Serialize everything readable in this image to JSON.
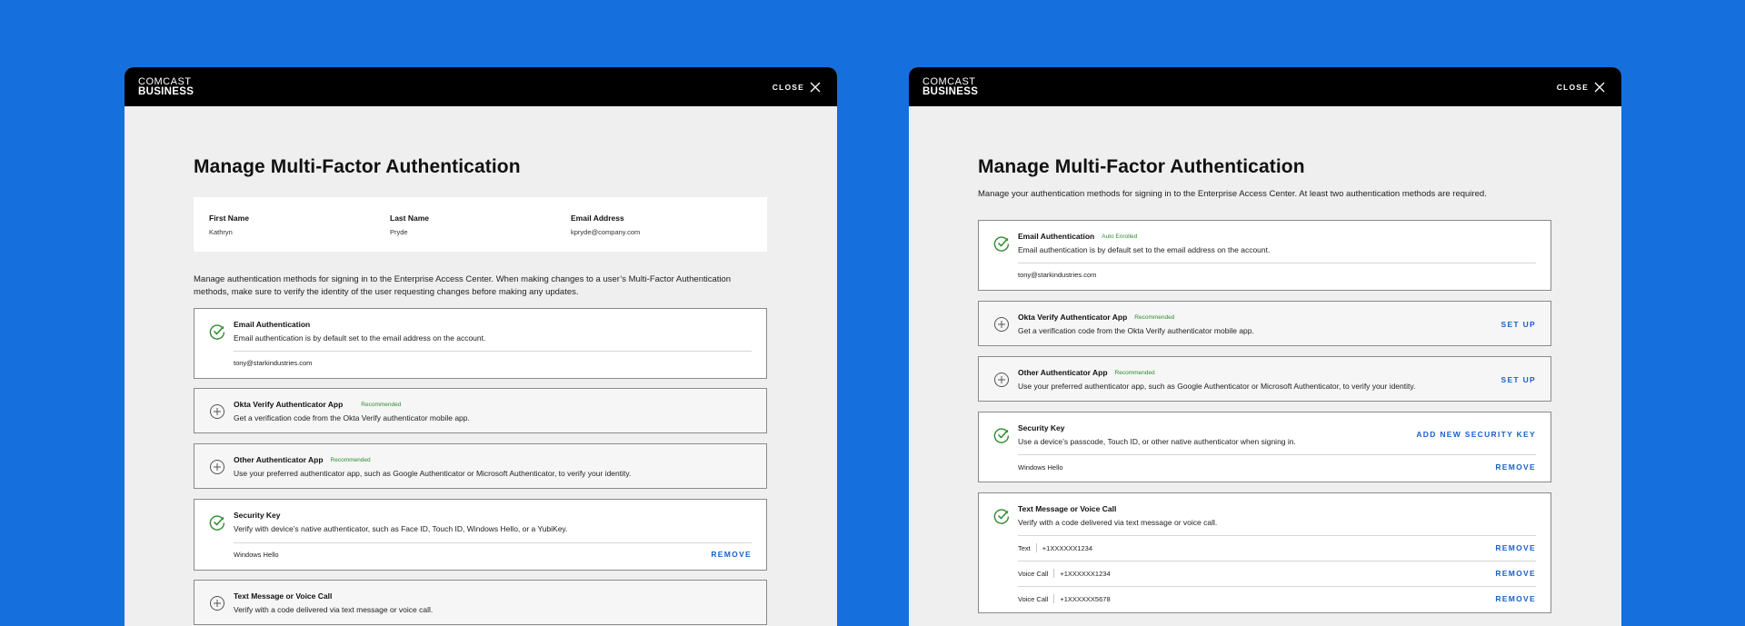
{
  "brand": {
    "line1": "COMCAST",
    "line2": "BUSINESS"
  },
  "close_label": "CLOSE",
  "colors": {
    "background": "#1570DE",
    "header": "#000000",
    "panel": "#EFEFEF",
    "success": "#2E8B2E",
    "link": "#1A5FC8"
  },
  "left": {
    "title": "Manage Multi-Factor Authentication",
    "user": {
      "first_name_label": "First Name",
      "first_name": "Kathryn",
      "last_name_label": "Last Name",
      "last_name": "Pryde",
      "email_label": "Email Address",
      "email": "kpryde@company.com"
    },
    "intro_line1": "Manage authentication methods for signing in to the Enterprise Access Center. When making changes to a user’s Multi-Factor Authentication",
    "intro_line2": "methods, make sure to verify the identity of the user requesting changes before making any updates.",
    "email_card": {
      "title": "Email Authentication",
      "desc": "Email authentication is by default set to the email address on the account.",
      "value": "tony@starkindustries.com",
      "icon": "check-circle-icon"
    },
    "okta_card": {
      "title": "Okta Verify Authenticator App",
      "badge": "Recommended",
      "desc": "Get a verification code from the Okta Verify authenticator mobile app.",
      "icon": "plus-circle-icon"
    },
    "other_card": {
      "title": "Other Authenticator App",
      "badge": "Recommended",
      "desc": "Use your preferred authenticator app, such as Google Authenticator or Microsoft Authenticator, to verify your identity.",
      "icon": "plus-circle-icon"
    },
    "security_card": {
      "title": "Security Key",
      "desc": "Verify with device’s native authenticator, such as Face ID, Touch ID, Windows Hello, or a YubiKey.",
      "value": "Windows Hello",
      "remove": "REMOVE",
      "icon": "check-circle-icon"
    },
    "text_card": {
      "title": "Text Message or Voice Call",
      "desc": "Verify with a code delivered via text message or voice call.",
      "icon": "plus-circle-icon"
    }
  },
  "right": {
    "title": "Manage Multi-Factor Authentication",
    "intro": "Manage your authentication methods for signing in to the Enterprise Access Center. At least two authentication methods are required.",
    "email_card": {
      "title": "Email Authentication",
      "badge": "Auto Enrolled",
      "desc": "Email authentication is by default set to the email address on the account.",
      "value": "tony@starkindustries.com",
      "icon": "check-circle-icon"
    },
    "okta_card": {
      "title": "Okta Verify Authenticator App",
      "badge": "Recommended",
      "desc": "Get a verification code from the Okta Verify authenticator mobile app.",
      "action": "SET UP",
      "icon": "plus-circle-icon"
    },
    "other_card": {
      "title": "Other Authenticator App",
      "badge": "Recommended",
      "desc": "Use your preferred authenticator app, such as Google Authenticator or Microsoft Authenticator, to verify your identity.",
      "action": "SET UP",
      "icon": "plus-circle-icon"
    },
    "security_card": {
      "title": "Security Key",
      "desc": "Use a device’s passcode, Touch ID, or other native authenticator when signing in.",
      "action": "ADD NEW SECURITY KEY",
      "value": "Windows Hello",
      "remove": "REMOVE",
      "icon": "check-circle-icon"
    },
    "text_card": {
      "title": "Text Message or Voice Call",
      "desc": "Verify with a code delivered via text message or voice call.",
      "icon": "check-circle-icon",
      "rows": [
        {
          "type": "Text",
          "number": "+1XXXXXX1234",
          "remove": "REMOVE"
        },
        {
          "type": "Voice Call",
          "number": "+1XXXXXX1234",
          "remove": "REMOVE"
        },
        {
          "type": "Voice Call",
          "number": "+1XXXXXX5678",
          "remove": "REMOVE"
        }
      ]
    }
  }
}
